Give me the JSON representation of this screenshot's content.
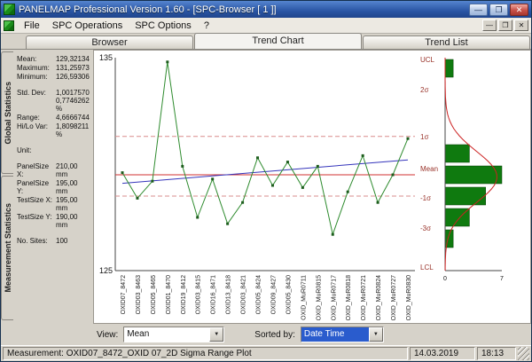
{
  "window": {
    "title": "PANELMAP   Professional Version 1.60 - [SPC-Browser [ 1 ]]",
    "controls": {
      "minimize": "—",
      "maximize": "❐",
      "close": "✕"
    },
    "child_controls": [
      "—",
      "❐",
      "✕"
    ]
  },
  "menu": {
    "items": [
      "File",
      "SPC Operations",
      "SPC Options",
      "?"
    ]
  },
  "tabs": [
    {
      "label": "Browser",
      "active": false
    },
    {
      "label": "Trend Chart",
      "active": true
    },
    {
      "label": "Trend List",
      "active": false
    }
  ],
  "side_tabs": [
    "Global Statistics",
    "Measurement Statistics"
  ],
  "stats": {
    "rows": [
      {
        "label": "Mean:",
        "values": [
          "129,32134"
        ]
      },
      {
        "label": "Maximum:",
        "values": [
          "131,25973"
        ]
      },
      {
        "label": "Minimum:",
        "values": [
          "126,59306"
        ]
      },
      {
        "spacer": true
      },
      {
        "label": "Std. Dev:",
        "values": [
          "1,0017570",
          "0,7746262 %"
        ]
      },
      {
        "label": "Range:",
        "values": [
          "4,6666744"
        ]
      },
      {
        "label": "Hi/Lo Var:",
        "values": [
          "1,8098211 %"
        ]
      },
      {
        "spacer": true
      },
      {
        "label": "Unit:",
        "values": [
          ""
        ]
      },
      {
        "spacer": true
      },
      {
        "label": "PanelSize X:",
        "values": [
          "210,00 mm"
        ]
      },
      {
        "label": "PanelSize Y:",
        "values": [
          "195,00 mm"
        ]
      },
      {
        "label": "TestSize X:",
        "values": [
          "195,00 mm"
        ]
      },
      {
        "label": "TestSize Y:",
        "values": [
          "190,00 mm"
        ]
      },
      {
        "spacer": true
      },
      {
        "label": "No. Sites:",
        "values": [
          "100"
        ]
      }
    ]
  },
  "controls": {
    "view_label": "View:",
    "view_value": "Mean",
    "sort_label": "Sorted by:",
    "sort_value": "Date Time"
  },
  "status": {
    "measurement": "Measurement: OXID07_8472_OXID 07_2D Sigma Range Plot",
    "date": "14.03.2019",
    "time": "18:13"
  },
  "icons": {
    "dropdown_arrow": "▼"
  },
  "colors": {
    "series_green": "#2e8b2e",
    "marker_green": "#1c5c1c",
    "mean_red": "#d03030",
    "sigma_pink": "#d98c8c",
    "trend_blue": "#3434bb",
    "hist_green": "#0f7a0f",
    "hist_edge": "#053c05",
    "curve_red": "#cc2222",
    "axis": "#444444",
    "sigma_label": "#99332a"
  },
  "chart_data": [
    {
      "type": "line",
      "title": "Trend Chart",
      "ylim": [
        125,
        135
      ],
      "yticks": [
        135,
        125
      ],
      "categories": [
        "OXID07_8472",
        "OXID03_8463",
        "OXID05_8465",
        "OXID01_8470",
        "OXID19_8412",
        "OXID03_8415",
        "OXID16_8471",
        "OXID13_8418",
        "OXID03_8421",
        "OXID05_8424",
        "OXID09_8427",
        "OXID05_8430",
        "OXID_MuR0711",
        "OXID_MuR0815",
        "OXID_MuR0717",
        "OXID_MuR0818",
        "OXID_MuR0721",
        "OXID_MuR0824",
        "OXID_MuR0727",
        "OXID_MuR0830"
      ],
      "values": [
        129.6,
        128.4,
        129.2,
        134.8,
        129.9,
        127.5,
        129.3,
        127.2,
        128.2,
        130.3,
        129.0,
        130.1,
        128.9,
        129.9,
        126.7,
        128.7,
        130.4,
        128.2,
        129.5,
        131.2
      ],
      "mean_line": 129.5,
      "dashed_lines": [
        131.3,
        128.5
      ],
      "trend_line": [
        129.1,
        130.2
      ],
      "right_axis_labels": [
        {
          "text": "UCL",
          "frac": 0.01
        },
        {
          "text": "2σ",
          "frac": 0.15
        },
        {
          "text": "1σ",
          "frac": 0.37
        },
        {
          "text": "Mean",
          "frac": 0.52
        },
        {
          "text": "-1σ",
          "frac": 0.66
        },
        {
          "text": "-3σ",
          "frac": 0.8
        },
        {
          "text": "LCL",
          "frac": 0.985
        }
      ]
    },
    {
      "type": "bar",
      "orientation": "horizontal",
      "xlim": [
        0,
        7
      ],
      "xticks": [
        0,
        7
      ],
      "values": [
        1,
        0,
        0,
        0,
        3,
        7,
        5,
        3,
        1,
        0
      ],
      "normal_curve": {
        "center_frac": 0.56,
        "sigma_frac": 0.12,
        "peak": 6.4
      }
    }
  ]
}
